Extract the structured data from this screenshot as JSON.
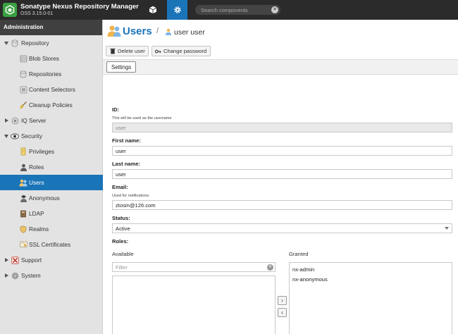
{
  "app": {
    "title": "Sonatype Nexus Repository Manager",
    "version": "OSS 3.15.0-01"
  },
  "header": {
    "search_placeholder": "Search components"
  },
  "sidebar": {
    "title": "Administration",
    "items": [
      {
        "label": "Repository",
        "icon": "database-icon",
        "level": 0,
        "expanded": true
      },
      {
        "label": "Blob Stores",
        "icon": "blob-store-icon",
        "level": 1
      },
      {
        "label": "Repositories",
        "icon": "database-icon",
        "level": 1
      },
      {
        "label": "Content Selectors",
        "icon": "content-selector-icon",
        "level": 1
      },
      {
        "label": "Cleanup Policies",
        "icon": "broom-icon",
        "level": 1
      },
      {
        "label": "IQ Server",
        "icon": "iq-server-icon",
        "level": 0,
        "expanded": false
      },
      {
        "label": "Security",
        "icon": "eye-icon",
        "level": 0,
        "expanded": true
      },
      {
        "label": "Privileges",
        "icon": "medal-icon",
        "level": 1
      },
      {
        "label": "Roles",
        "icon": "user-icon",
        "level": 1
      },
      {
        "label": "Users",
        "icon": "users-icon",
        "level": 1,
        "selected": true
      },
      {
        "label": "Anonymous",
        "icon": "anonymous-icon",
        "level": 1
      },
      {
        "label": "LDAP",
        "icon": "book-icon",
        "level": 1
      },
      {
        "label": "Realms",
        "icon": "shield-icon",
        "level": 1
      },
      {
        "label": "SSL Certificates",
        "icon": "certificate-icon",
        "level": 1
      },
      {
        "label": "Support",
        "icon": "support-icon",
        "level": 0,
        "expanded": false
      },
      {
        "label": "System",
        "icon": "gear-icon",
        "level": 0,
        "expanded": false
      }
    ]
  },
  "page": {
    "title": "Users",
    "separator": "/",
    "subtitle": "user user"
  },
  "toolbar": {
    "delete_label": "Delete user",
    "change_password_label": "Change password"
  },
  "tabs": {
    "settings_label": "Settings"
  },
  "form": {
    "id_label": "ID:",
    "id_help": "This will be used as the username",
    "id_value": "user",
    "first_name_label": "First name:",
    "first_name_value": "user",
    "last_name_label": "Last name:",
    "last_name_value": "user",
    "email_label": "Email:",
    "email_help": "Used for notifications",
    "email_value": "ztosin@126.com",
    "status_label": "Status:",
    "status_value": "Active",
    "roles_label": "Roles:",
    "available_label": "Available",
    "granted_label": "Granted",
    "filter_placeholder": "Filter",
    "move_right_glyph": "›",
    "move_left_glyph": "‹",
    "granted": [
      "nx-admin",
      "nx-anonymous"
    ]
  },
  "colors": {
    "accent": "#1a74b8",
    "topbar": "#2b2b2b",
    "sidebar": "#e3e3e3"
  }
}
